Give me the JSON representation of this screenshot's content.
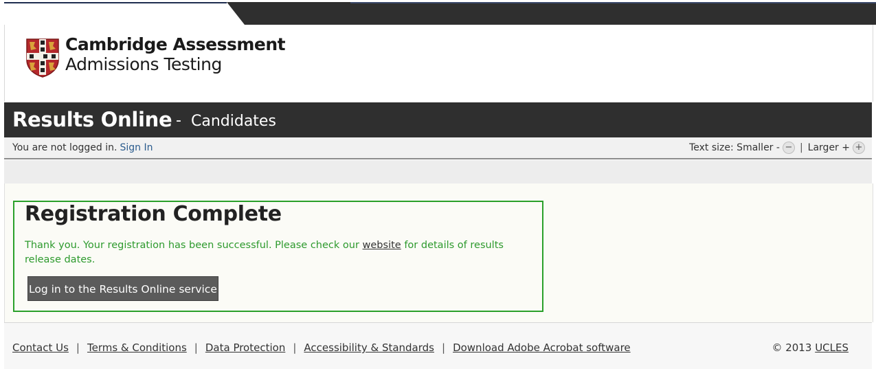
{
  "brand": {
    "line1": "Cambridge Assessment",
    "line2": "Admissions Testing",
    "crest_icon": "university-crest-icon",
    "colors": {
      "crest_red": "#b5282c",
      "crest_gold": "#d9a23a"
    }
  },
  "titlebar": {
    "title": "Results Online",
    "separator": "-",
    "subtitle": "Candidates"
  },
  "loginbar": {
    "status_text": "You are not logged in.",
    "signin_label": "Sign In",
    "textsize_label": "Text size: Smaller -",
    "smaller_icon": "minus",
    "separator": "|",
    "larger_label": "Larger +",
    "larger_icon": "plus"
  },
  "main": {
    "heading": "Registration Complete",
    "message_before": "Thank you. Your registration has been successful. Please check our",
    "message_link": "website",
    "message_after": "for details of results release dates.",
    "login_button": "Log in to the Results Online service",
    "colors": {
      "success": "#2aa02a"
    }
  },
  "footer": {
    "links": [
      "Contact Us",
      "Terms & Conditions",
      "Data Protection",
      "Accessibility & Standards",
      "Download Adobe Acrobat software"
    ],
    "link_separator": "|",
    "copyright_prefix": "© 2013",
    "copyright_link": "UCLES"
  }
}
